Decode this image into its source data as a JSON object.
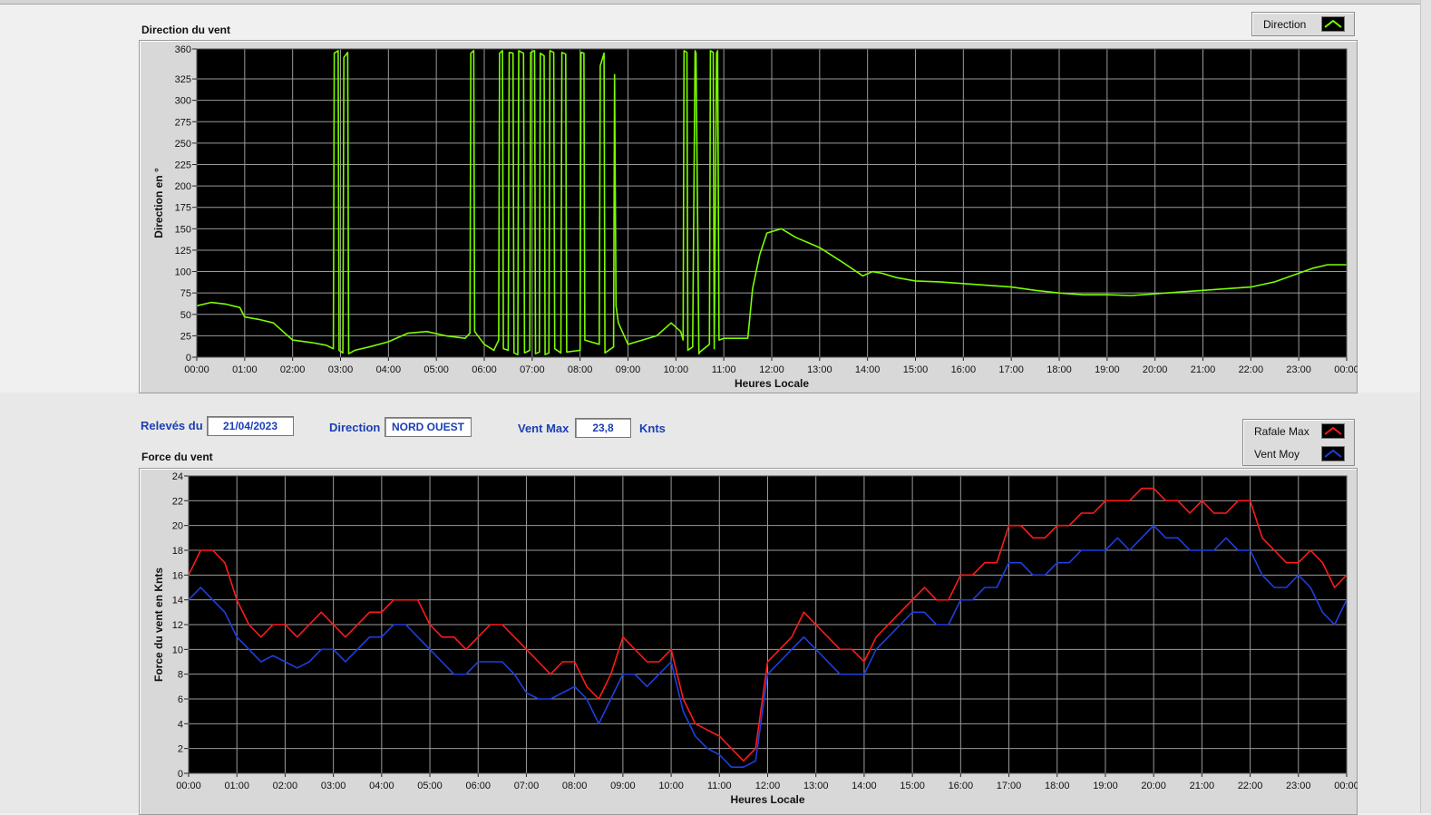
{
  "direction_chart": {
    "title": "Direction du vent",
    "legend": [
      {
        "name": "Direction",
        "color": "#7cfc00"
      }
    ]
  },
  "force_chart": {
    "title": "Force du vent",
    "legend": [
      {
        "name": "Rafale Max",
        "color": "#ff1a1a"
      },
      {
        "name": "Vent Moy",
        "color": "#1f3fe0"
      }
    ]
  },
  "info": {
    "date_label": "Relevés du",
    "date_value": "21/04/2023",
    "direction_label": "Direction",
    "direction_value": "NORD OUEST",
    "vmax_label": "Vent Max",
    "vmax_value": "23,8",
    "vmax_unit": "Knts"
  },
  "chart_data": [
    {
      "type": "line",
      "title": "",
      "xlabel": "Heures Locale",
      "ylabel": "Direction en °",
      "xlim": [
        0,
        24
      ],
      "ylim": [
        0,
        360
      ],
      "x_tick_labels": [
        "00:00",
        "01:00",
        "02:00",
        "03:00",
        "04:00",
        "05:00",
        "06:00",
        "07:00",
        "08:00",
        "09:00",
        "10:00",
        "11:00",
        "12:00",
        "13:00",
        "14:00",
        "15:00",
        "16:00",
        "17:00",
        "18:00",
        "19:00",
        "20:00",
        "21:00",
        "22:00",
        "23:00",
        "00:00"
      ],
      "y_ticks": [
        0,
        25,
        50,
        75,
        100,
        125,
        150,
        175,
        200,
        225,
        250,
        275,
        300,
        325,
        360
      ],
      "grid": true,
      "legend_position": "top-right",
      "series": [
        {
          "name": "Direction",
          "color": "#7cfc00",
          "x": [
            0,
            0.3,
            0.6,
            0.9,
            1.0,
            1.3,
            1.6,
            1.8,
            2.0,
            2.4,
            2.7,
            2.85,
            2.87,
            2.95,
            2.97,
            3.05,
            3.07,
            3.15,
            3.17,
            3.3,
            3.6,
            4.0,
            4.4,
            4.8,
            5.2,
            5.6,
            5.7,
            5.72,
            5.78,
            5.8,
            6.0,
            6.2,
            6.3,
            6.32,
            6.38,
            6.4,
            6.5,
            6.52,
            6.6,
            6.62,
            6.7,
            6.72,
            6.82,
            6.84,
            6.95,
            6.97,
            7.05,
            7.07,
            7.15,
            7.17,
            7.25,
            7.27,
            7.35,
            7.37,
            7.45,
            7.47,
            7.6,
            7.62,
            7.7,
            7.72,
            8.0,
            8.02,
            8.08,
            8.1,
            8.4,
            8.42,
            8.5,
            8.52,
            8.7,
            8.72,
            8.75,
            8.8,
            9.0,
            9.3,
            9.6,
            9.9,
            10.1,
            10.15,
            10.17,
            10.23,
            10.25,
            10.35,
            10.4,
            10.42,
            10.48,
            10.5,
            10.7,
            10.72,
            10.78,
            10.8,
            10.85,
            10.87,
            10.9,
            11.0,
            11.5,
            11.6,
            11.75,
            11.9,
            12.2,
            12.5,
            13.0,
            13.5,
            13.9,
            14.1,
            14.3,
            14.6,
            15.0,
            15.5,
            16.0,
            16.5,
            17.0,
            17.5,
            18.0,
            18.5,
            19.0,
            19.5,
            20.0,
            20.5,
            21.0,
            21.5,
            22.0,
            22.5,
            23.0,
            23.3,
            23.6,
            24.0
          ],
          "y": [
            60,
            64,
            62,
            58,
            47,
            44,
            40,
            30,
            20,
            17,
            14,
            10,
            355,
            358,
            8,
            5,
            350,
            356,
            4,
            8,
            12,
            18,
            28,
            30,
            25,
            22,
            28,
            355,
            358,
            30,
            15,
            8,
            20,
            355,
            358,
            10,
            8,
            356,
            355,
            5,
            3,
            358,
            355,
            5,
            8,
            356,
            358,
            4,
            6,
            355,
            352,
            3,
            5,
            358,
            356,
            10,
            5,
            356,
            354,
            6,
            8,
            356,
            355,
            20,
            15,
            340,
            355,
            5,
            12,
            330,
            60,
            40,
            15,
            20,
            25,
            40,
            30,
            20,
            358,
            356,
            8,
            12,
            358,
            355,
            4,
            6,
            15,
            358,
            356,
            10,
            355,
            358,
            20,
            22,
            22,
            80,
            120,
            145,
            150,
            140,
            128,
            110,
            95,
            100,
            98,
            93,
            89,
            88,
            86,
            84,
            82,
            78,
            75,
            73,
            73,
            72,
            74,
            76,
            78,
            80,
            82,
            88,
            98,
            104,
            108,
            108
          ]
        }
      ]
    },
    {
      "type": "line",
      "title": "",
      "xlabel": "Heures Locale",
      "ylabel": "Force du vent en Knts",
      "xlim": [
        0,
        24
      ],
      "ylim": [
        0,
        24
      ],
      "x_tick_labels": [
        "00:00",
        "01:00",
        "02:00",
        "03:00",
        "04:00",
        "05:00",
        "06:00",
        "07:00",
        "08:00",
        "09:00",
        "10:00",
        "11:00",
        "12:00",
        "13:00",
        "14:00",
        "15:00",
        "16:00",
        "17:00",
        "18:00",
        "19:00",
        "20:00",
        "21:00",
        "22:00",
        "23:00",
        "00:00"
      ],
      "y_ticks": [
        0,
        2,
        4,
        6,
        8,
        10,
        12,
        14,
        16,
        18,
        20,
        22,
        24
      ],
      "grid": true,
      "legend_position": "top-right",
      "series": [
        {
          "name": "Rafale Max",
          "color": "#ff1a1a",
          "x": [
            0,
            0.25,
            0.5,
            0.75,
            1.0,
            1.25,
            1.5,
            1.75,
            2.0,
            2.25,
            2.5,
            2.75,
            3.0,
            3.25,
            3.5,
            3.75,
            4.0,
            4.25,
            4.5,
            4.75,
            5.0,
            5.25,
            5.5,
            5.75,
            6.0,
            6.25,
            6.5,
            6.75,
            7.0,
            7.25,
            7.5,
            7.75,
            8.0,
            8.25,
            8.5,
            8.75,
            9.0,
            9.25,
            9.5,
            9.75,
            10.0,
            10.25,
            10.5,
            10.75,
            11.0,
            11.25,
            11.5,
            11.75,
            12.0,
            12.25,
            12.5,
            12.75,
            13.0,
            13.25,
            13.5,
            13.75,
            14.0,
            14.25,
            14.5,
            14.75,
            15.0,
            15.25,
            15.5,
            15.75,
            16.0,
            16.25,
            16.5,
            16.75,
            17.0,
            17.25,
            17.5,
            17.75,
            18.0,
            18.25,
            18.5,
            18.75,
            19.0,
            19.25,
            19.5,
            19.75,
            20.0,
            20.25,
            20.5,
            20.75,
            21.0,
            21.25,
            21.5,
            21.75,
            22.0,
            22.25,
            22.5,
            22.75,
            23.0,
            23.25,
            23.5,
            23.75,
            24.0
          ],
          "y": [
            16,
            18,
            18,
            17,
            14,
            12,
            11,
            12,
            12,
            11,
            12,
            13,
            12,
            11,
            12,
            13,
            13,
            14,
            14,
            14,
            12,
            11,
            11,
            10,
            11,
            12,
            12,
            11,
            10,
            9,
            8,
            9,
            9,
            7,
            6,
            8,
            11,
            10,
            9,
            9,
            10,
            6,
            4,
            3.5,
            3,
            2,
            1,
            2,
            9,
            10,
            11,
            13,
            12,
            11,
            10,
            10,
            9,
            11,
            12,
            13,
            14,
            15,
            14,
            14,
            16,
            16,
            17,
            17,
            20,
            20,
            19,
            19,
            20,
            20,
            21,
            21,
            22,
            22,
            22,
            23,
            23,
            22,
            22,
            21,
            22,
            21,
            21,
            22,
            22,
            19,
            18,
            17,
            17,
            18,
            17,
            15,
            16
          ]
        },
        {
          "name": "Vent Moy",
          "color": "#1f3fe0",
          "x": [
            0,
            0.25,
            0.5,
            0.75,
            1.0,
            1.25,
            1.5,
            1.75,
            2.0,
            2.25,
            2.5,
            2.75,
            3.0,
            3.25,
            3.5,
            3.75,
            4.0,
            4.25,
            4.5,
            4.75,
            5.0,
            5.25,
            5.5,
            5.75,
            6.0,
            6.25,
            6.5,
            6.75,
            7.0,
            7.25,
            7.5,
            7.75,
            8.0,
            8.25,
            8.5,
            8.75,
            9.0,
            9.25,
            9.5,
            9.75,
            10.0,
            10.25,
            10.5,
            10.75,
            11.0,
            11.25,
            11.5,
            11.75,
            12.0,
            12.25,
            12.5,
            12.75,
            13.0,
            13.25,
            13.5,
            13.75,
            14.0,
            14.25,
            14.5,
            14.75,
            15.0,
            15.25,
            15.5,
            15.75,
            16.0,
            16.25,
            16.5,
            16.75,
            17.0,
            17.25,
            17.5,
            17.75,
            18.0,
            18.25,
            18.5,
            18.75,
            19.0,
            19.25,
            19.5,
            19.75,
            20.0,
            20.25,
            20.5,
            20.75,
            21.0,
            21.25,
            21.5,
            21.75,
            22.0,
            22.25,
            22.5,
            22.75,
            23.0,
            23.25,
            23.5,
            23.75,
            24.0
          ],
          "y": [
            14,
            15,
            14,
            13,
            11,
            10,
            9,
            9.5,
            9,
            8.5,
            9,
            10,
            10,
            9,
            10,
            11,
            11,
            12,
            12,
            11,
            10,
            9,
            8,
            8,
            9,
            9,
            9,
            8,
            6.5,
            6,
            6,
            6.5,
            7,
            6,
            4,
            6,
            8,
            8,
            7,
            8,
            9,
            5,
            3,
            2,
            1.5,
            0.5,
            0.5,
            1,
            8,
            9,
            10,
            11,
            10,
            9,
            8,
            8,
            8,
            10,
            11,
            12,
            13,
            13,
            12,
            12,
            14,
            14,
            15,
            15,
            17,
            17,
            16,
            16,
            17,
            17,
            18,
            18,
            18,
            19,
            18,
            19,
            20,
            19,
            19,
            18,
            18,
            18,
            19,
            18,
            18,
            16,
            15,
            15,
            16,
            15,
            13,
            12,
            14
          ]
        }
      ]
    }
  ]
}
